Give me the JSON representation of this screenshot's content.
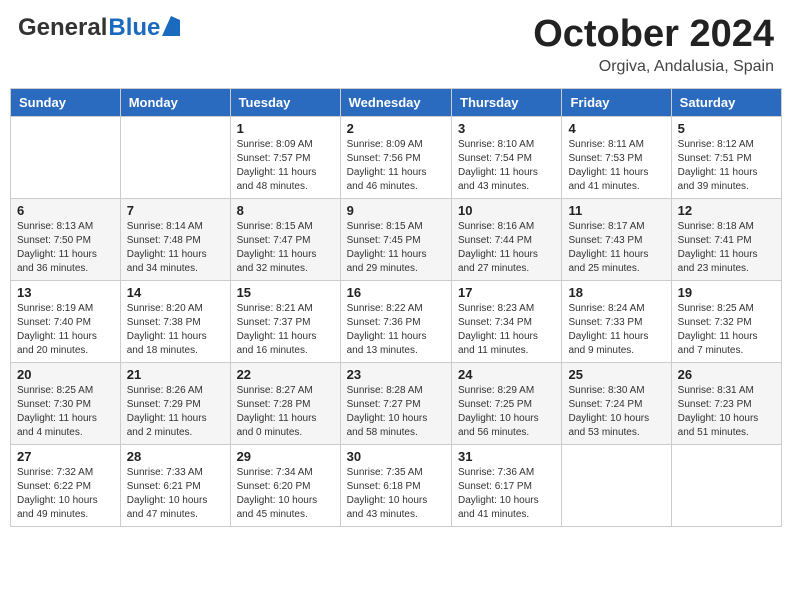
{
  "header": {
    "logo_general": "General",
    "logo_blue": "Blue",
    "month_title": "October 2024",
    "location": "Orgiva, Andalusia, Spain"
  },
  "days_of_week": [
    "Sunday",
    "Monday",
    "Tuesday",
    "Wednesday",
    "Thursday",
    "Friday",
    "Saturday"
  ],
  "weeks": [
    [
      {
        "day": "",
        "info": ""
      },
      {
        "day": "",
        "info": ""
      },
      {
        "day": "1",
        "info": "Sunrise: 8:09 AM\nSunset: 7:57 PM\nDaylight: 11 hours and 48 minutes."
      },
      {
        "day": "2",
        "info": "Sunrise: 8:09 AM\nSunset: 7:56 PM\nDaylight: 11 hours and 46 minutes."
      },
      {
        "day": "3",
        "info": "Sunrise: 8:10 AM\nSunset: 7:54 PM\nDaylight: 11 hours and 43 minutes."
      },
      {
        "day": "4",
        "info": "Sunrise: 8:11 AM\nSunset: 7:53 PM\nDaylight: 11 hours and 41 minutes."
      },
      {
        "day": "5",
        "info": "Sunrise: 8:12 AM\nSunset: 7:51 PM\nDaylight: 11 hours and 39 minutes."
      }
    ],
    [
      {
        "day": "6",
        "info": "Sunrise: 8:13 AM\nSunset: 7:50 PM\nDaylight: 11 hours and 36 minutes."
      },
      {
        "day": "7",
        "info": "Sunrise: 8:14 AM\nSunset: 7:48 PM\nDaylight: 11 hours and 34 minutes."
      },
      {
        "day": "8",
        "info": "Sunrise: 8:15 AM\nSunset: 7:47 PM\nDaylight: 11 hours and 32 minutes."
      },
      {
        "day": "9",
        "info": "Sunrise: 8:15 AM\nSunset: 7:45 PM\nDaylight: 11 hours and 29 minutes."
      },
      {
        "day": "10",
        "info": "Sunrise: 8:16 AM\nSunset: 7:44 PM\nDaylight: 11 hours and 27 minutes."
      },
      {
        "day": "11",
        "info": "Sunrise: 8:17 AM\nSunset: 7:43 PM\nDaylight: 11 hours and 25 minutes."
      },
      {
        "day": "12",
        "info": "Sunrise: 8:18 AM\nSunset: 7:41 PM\nDaylight: 11 hours and 23 minutes."
      }
    ],
    [
      {
        "day": "13",
        "info": "Sunrise: 8:19 AM\nSunset: 7:40 PM\nDaylight: 11 hours and 20 minutes."
      },
      {
        "day": "14",
        "info": "Sunrise: 8:20 AM\nSunset: 7:38 PM\nDaylight: 11 hours and 18 minutes."
      },
      {
        "day": "15",
        "info": "Sunrise: 8:21 AM\nSunset: 7:37 PM\nDaylight: 11 hours and 16 minutes."
      },
      {
        "day": "16",
        "info": "Sunrise: 8:22 AM\nSunset: 7:36 PM\nDaylight: 11 hours and 13 minutes."
      },
      {
        "day": "17",
        "info": "Sunrise: 8:23 AM\nSunset: 7:34 PM\nDaylight: 11 hours and 11 minutes."
      },
      {
        "day": "18",
        "info": "Sunrise: 8:24 AM\nSunset: 7:33 PM\nDaylight: 11 hours and 9 minutes."
      },
      {
        "day": "19",
        "info": "Sunrise: 8:25 AM\nSunset: 7:32 PM\nDaylight: 11 hours and 7 minutes."
      }
    ],
    [
      {
        "day": "20",
        "info": "Sunrise: 8:25 AM\nSunset: 7:30 PM\nDaylight: 11 hours and 4 minutes."
      },
      {
        "day": "21",
        "info": "Sunrise: 8:26 AM\nSunset: 7:29 PM\nDaylight: 11 hours and 2 minutes."
      },
      {
        "day": "22",
        "info": "Sunrise: 8:27 AM\nSunset: 7:28 PM\nDaylight: 11 hours and 0 minutes."
      },
      {
        "day": "23",
        "info": "Sunrise: 8:28 AM\nSunset: 7:27 PM\nDaylight: 10 hours and 58 minutes."
      },
      {
        "day": "24",
        "info": "Sunrise: 8:29 AM\nSunset: 7:25 PM\nDaylight: 10 hours and 56 minutes."
      },
      {
        "day": "25",
        "info": "Sunrise: 8:30 AM\nSunset: 7:24 PM\nDaylight: 10 hours and 53 minutes."
      },
      {
        "day": "26",
        "info": "Sunrise: 8:31 AM\nSunset: 7:23 PM\nDaylight: 10 hours and 51 minutes."
      }
    ],
    [
      {
        "day": "27",
        "info": "Sunrise: 7:32 AM\nSunset: 6:22 PM\nDaylight: 10 hours and 49 minutes."
      },
      {
        "day": "28",
        "info": "Sunrise: 7:33 AM\nSunset: 6:21 PM\nDaylight: 10 hours and 47 minutes."
      },
      {
        "day": "29",
        "info": "Sunrise: 7:34 AM\nSunset: 6:20 PM\nDaylight: 10 hours and 45 minutes."
      },
      {
        "day": "30",
        "info": "Sunrise: 7:35 AM\nSunset: 6:18 PM\nDaylight: 10 hours and 43 minutes."
      },
      {
        "day": "31",
        "info": "Sunrise: 7:36 AM\nSunset: 6:17 PM\nDaylight: 10 hours and 41 minutes."
      },
      {
        "day": "",
        "info": ""
      },
      {
        "day": "",
        "info": ""
      }
    ]
  ]
}
